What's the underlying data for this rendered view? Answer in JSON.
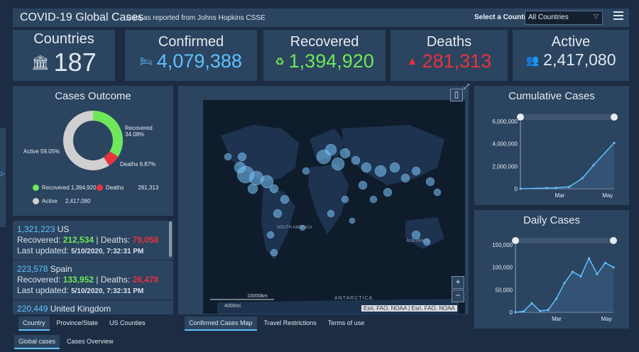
{
  "header": {
    "title": "COVID-19 Global Cases",
    "subtitle": "Data as reported from Johns Hopkins CSSE",
    "select_label": "Select a Country",
    "select_value": "All Countries"
  },
  "stats": {
    "countries": {
      "label": "Countries",
      "value": "187"
    },
    "confirmed": {
      "label": "Confirmed",
      "value": "4,079,388"
    },
    "recovered": {
      "label": "Recovered",
      "value": "1,394,920"
    },
    "deaths": {
      "label": "Deaths",
      "value": "281,313"
    },
    "active": {
      "label": "Active",
      "value": "2,417,080"
    }
  },
  "colors": {
    "confirmed": "#5fc1ff",
    "recovered": "#6ee85a",
    "deaths": "#e8323c",
    "active": "#d0d0d0"
  },
  "outcome": {
    "title": "Cases Outcome",
    "recovered_label": "Recovered 34.08%",
    "active_label": "Active 59.05%",
    "deaths_label": "Deaths 6.87%",
    "legend": [
      {
        "name": "Recovered",
        "value": "1,394,920"
      },
      {
        "name": "Deaths",
        "value": "281,313"
      },
      {
        "name": "Active",
        "value": "2,417,080"
      }
    ]
  },
  "country_list": [
    {
      "count": "1,321,223",
      "name": "US",
      "recovered": "212,534",
      "deaths": "79,058",
      "updated": "5/10/2020, 7:32:31 PM"
    },
    {
      "count": "223,578",
      "name": "Spain",
      "recovered": "133,952",
      "deaths": "26,478",
      "updated": "5/10/2020, 7:32:31 PM"
    },
    {
      "count": "220,449",
      "name": "United Kingdom"
    }
  ],
  "list_text": {
    "recovered_prefix": "Recovered: ",
    "deaths_prefix": " | Deaths: ",
    "updated_prefix": "Last updated: "
  },
  "left_tabs": [
    "Country",
    "Province/State",
    "US Counties"
  ],
  "map_tabs": [
    "Confirmed Cases Map",
    "Travel Restrictions",
    "Terms of use"
  ],
  "bottom_tabs": [
    "Global cases",
    "Cases Overview"
  ],
  "map": {
    "labels": [
      "SOUTH AMERICA",
      "AUSTRALIA",
      "ANTARCTICA"
    ],
    "scale_km": "10000km",
    "scale_mi": "4000mi",
    "attribution": "Esri, FAO, NOAA | Esri, FAO, NOAA",
    "zoom_in": "+",
    "zoom_out": "−"
  },
  "chart_data": [
    {
      "type": "area",
      "title": "Cumulative Cases",
      "x": [
        "Jan 22",
        "Feb 15",
        "Mar 1",
        "Mar 15",
        "Apr 1",
        "Apr 15",
        "May 10"
      ],
      "values": [
        550,
        70000,
        88000,
        170000,
        930000,
        2100000,
        4079388
      ],
      "x_ticks": [
        "Mar",
        "May"
      ],
      "y_ticks": [
        "6,000,000",
        "4,000,000",
        "2,000,000",
        "0"
      ],
      "ylim": [
        0,
        6000000
      ]
    },
    {
      "type": "line",
      "title": "Daily Cases",
      "x": [
        "Jan 22",
        "Feb 12",
        "Feb 20",
        "Mar 1",
        "Mar 10",
        "Mar 20",
        "Mar 28",
        "Apr 4",
        "Apr 12",
        "Apr 20",
        "Apr 28",
        "May 5",
        "May 10"
      ],
      "values": [
        0,
        2000,
        20000,
        3000,
        5000,
        30000,
        65000,
        90000,
        80000,
        120000,
        85000,
        110000,
        100000
      ],
      "x_ticks": [
        "Mar",
        "May"
      ],
      "y_ticks": [
        "150,000",
        "100,000",
        "50,000",
        "0"
      ],
      "ylim": [
        0,
        150000
      ]
    }
  ]
}
